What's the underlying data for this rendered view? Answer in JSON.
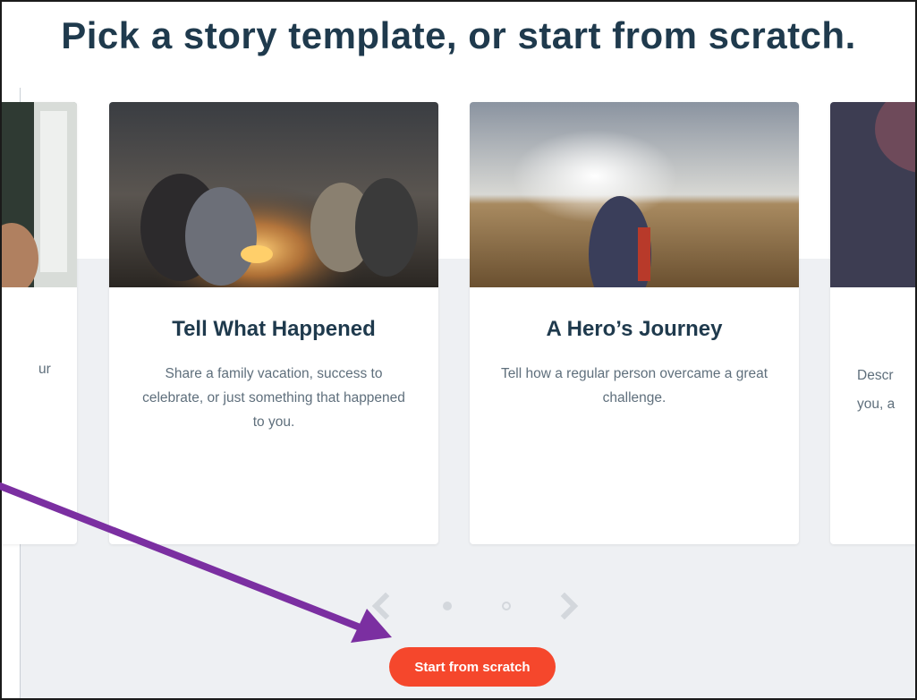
{
  "page": {
    "title": "Pick a story template, or start from scratch."
  },
  "cards": [
    {
      "title": "",
      "desc_partial": "ur"
    },
    {
      "title": "Tell What Happened",
      "description": "Share a family vacation, success to celebrate, or just something that happened to you."
    },
    {
      "title": "A Hero’s Journey",
      "description": "Tell how a regular person overcame a great challenge."
    },
    {
      "title": "",
      "desc_line1": "Descr",
      "desc_line2": "you, a"
    }
  ],
  "carousel": {
    "prev_icon": "chevron-left-icon",
    "next_icon": "chevron-right-icon",
    "dots": [
      {
        "state": "active"
      },
      {
        "state": "inactive"
      }
    ]
  },
  "actions": {
    "start_label": "Start from scratch"
  },
  "colors": {
    "title": "#1f3a4d",
    "body_text": "#5f6f7c",
    "panel_gray": "#eef0f3",
    "start_button": "#f5472c",
    "annotation_arrow": "#7b2fa1"
  }
}
